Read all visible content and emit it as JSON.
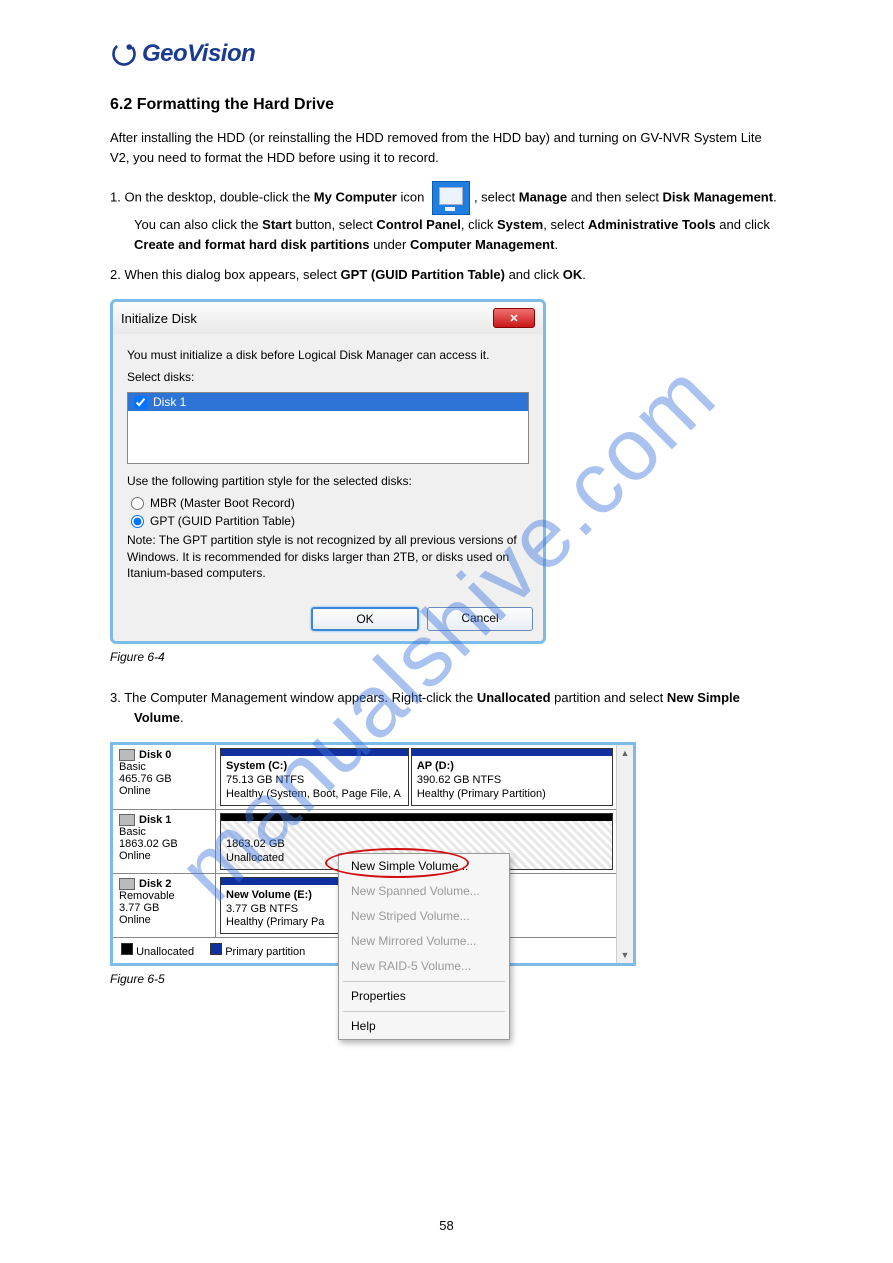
{
  "logo": {
    "text": "GeoVision"
  },
  "section_title": "6.2  Formatting the Hard Drive",
  "intro": "After installing the HDD (or reinstalling the HDD removed from the HDD bay) and turning on GV-NVR System Lite V2, you need to format the HDD before using it to record.",
  "steps": {
    "s1_a": "1.  On the desktop, double-click the ",
    "s1_b_bold": "My Computer",
    "s1_c": " icon ",
    "s1_d": ", select ",
    "s1_e_bold": "Manage",
    "s1_f": " and then select ",
    "s1_g_bold": "Disk Management",
    "s1_h": ". You can also click the ",
    "s1_i_bold": "Start",
    "s1_j": " button, select ",
    "s1_k_bold": "Control Panel",
    "s1_l": ", click ",
    "s1_m_bold": "System",
    "s1_n": ", select ",
    "s1_o_bold": "Administrative Tools",
    "s1_p": " and click ",
    "s1_q_bold": "Create and format hard disk partitions",
    "s1_r": " under ",
    "s1_s_bold": "Computer Management",
    "s1_t": ".",
    "s2": "2.  When this dialog box appears, select ",
    "s2_b": "GPT (GUID Partition Table)",
    "s2_c": " and click ",
    "s2_d": "OK",
    "s2_e": ".",
    "s3": "3.  The Computer Management window appears. Right-click the ",
    "s3_b": "Unallocated",
    "s3_c": " partition and select ",
    "s3_d": "New Simple Volume",
    "s3_e": "."
  },
  "dlg": {
    "title": "Initialize Disk",
    "msg": "You must initialize a disk before Logical Disk Manager can access it.",
    "select_label": "Select disks:",
    "disk_item": "Disk 1",
    "use_label": "Use the following partition style for the selected disks:",
    "opt_mbr": "MBR (Master Boot Record)",
    "opt_gpt": "GPT (GUID Partition Table)",
    "note": "Note: The GPT partition style is not recognized by all previous versions of Windows. It is recommended for disks larger than 2TB, or disks used on Itanium-based computers.",
    "ok": "OK",
    "cancel": "Cancel"
  },
  "fig1_label": "Figure 6-4",
  "fig2_label": "Figure 6-5",
  "dm": {
    "disk0": {
      "name": "Disk 0",
      "type": "Basic",
      "size": "465.76 GB",
      "status": "Online"
    },
    "disk0_p1": {
      "title": "System  (C:)",
      "l1": "75.13 GB NTFS",
      "l2": "Healthy (System, Boot, Page File, A"
    },
    "disk0_p2": {
      "title": "AP  (D:)",
      "l1": "390.62 GB NTFS",
      "l2": "Healthy (Primary Partition)"
    },
    "disk1": {
      "name": "Disk 1",
      "type": "Basic",
      "size": "1863.02 GB",
      "status": "Online"
    },
    "disk1_p": {
      "l1": "1863.02 GB",
      "l2": "Unallocated"
    },
    "disk2": {
      "name": "Disk 2",
      "type": "Removable",
      "size": "3.77 GB",
      "status": "Online"
    },
    "disk2_p": {
      "title": "New Volume  (E:)",
      "l1": "3.77 GB NTFS",
      "l2": "Healthy (Primary Pa"
    },
    "legend_unalloc": "Unallocated",
    "legend_primary": "Primary partition"
  },
  "ctx": {
    "m1": "New Simple Volume...",
    "m2": "New Spanned Volume...",
    "m3": "New Striped Volume...",
    "m4": "New Mirrored Volume...",
    "m5": "New RAID-5 Volume...",
    "m6": "Properties",
    "m7": "Help"
  },
  "page_number": "58",
  "watermark": "manualshive.com"
}
